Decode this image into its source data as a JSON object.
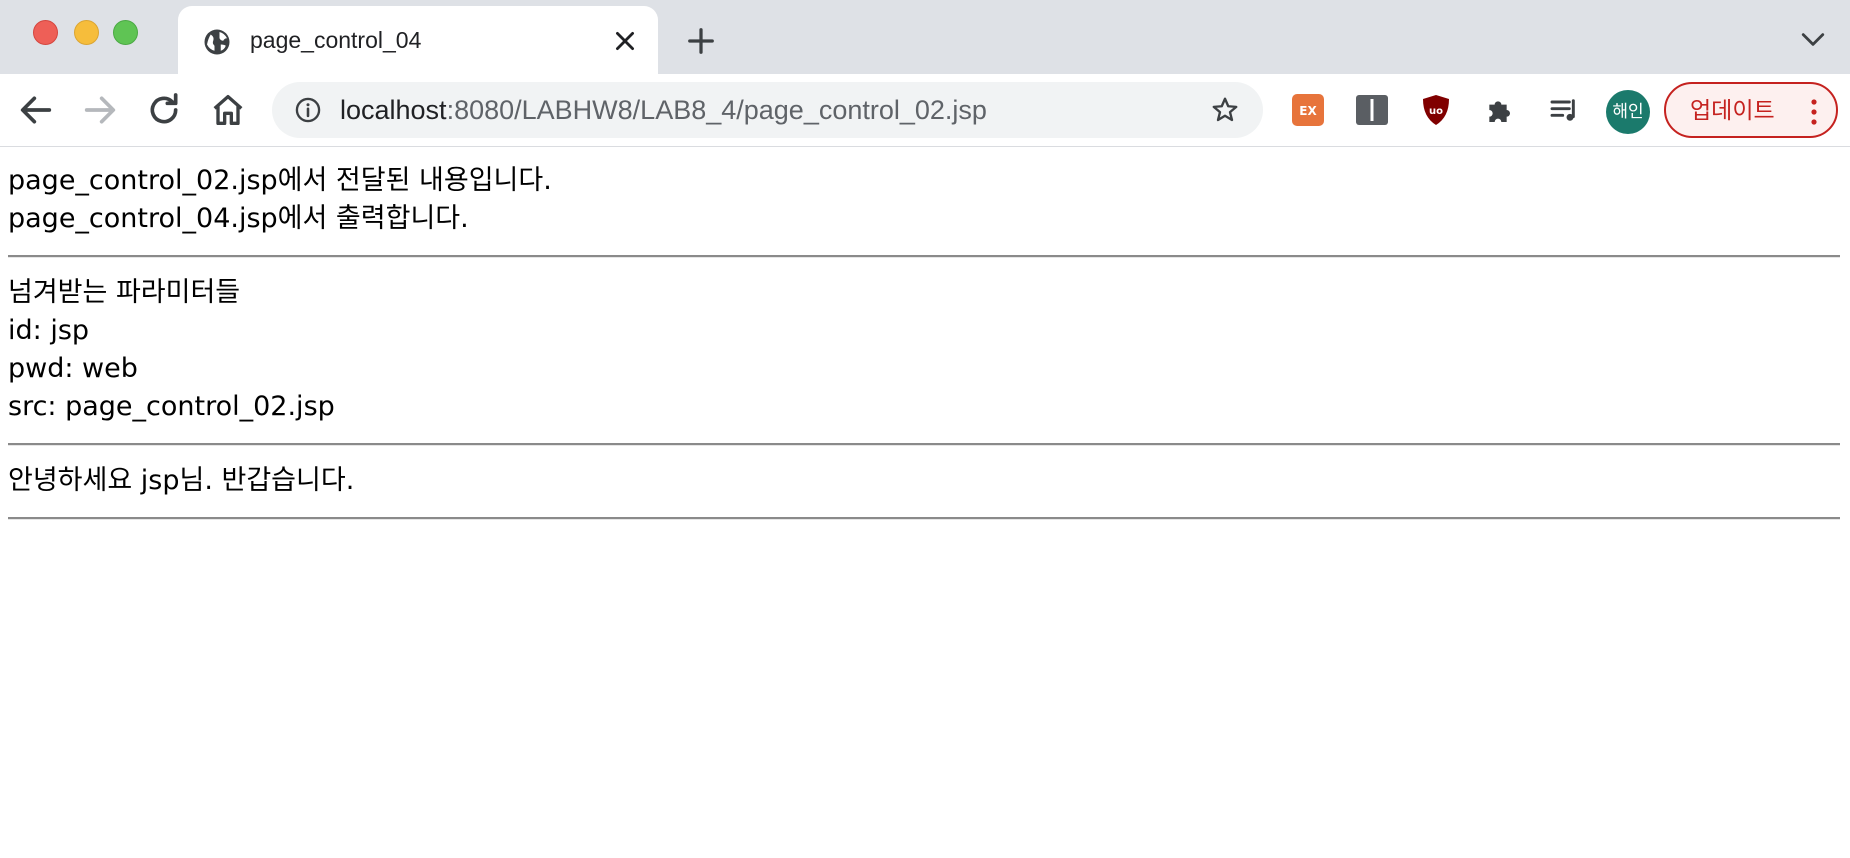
{
  "window": {
    "tab_title": "page_control_04",
    "url_host": "localhost",
    "url_path": ":8080/LABHW8/LAB8_4/page_control_02.jsp"
  },
  "toolbar": {
    "avatar_text": "해인",
    "update_label": "업데이트",
    "extensions": [
      "ex-extension-icon",
      "book-extension-icon",
      "ublock-shield-icon",
      "puzzle-extensions-icon",
      "media-queue-icon"
    ]
  },
  "page": {
    "intro": [
      "page_control_02.jsp에서 전달된 내용입니다.",
      "page_control_04.jsp에서 출력합니다."
    ],
    "params_heading": "넘겨받는 파라미터들",
    "params": [
      "id: jsp",
      "pwd: web",
      "src: page_control_02.jsp"
    ],
    "greeting": "안녕하세요 jsp님. 반갑습니다."
  },
  "colors": {
    "tabstrip_bg": "#dee1e6",
    "omnibox_bg": "#f1f3f4",
    "update_accent": "#c5221f",
    "avatar_bg": "#1b7a6c"
  }
}
